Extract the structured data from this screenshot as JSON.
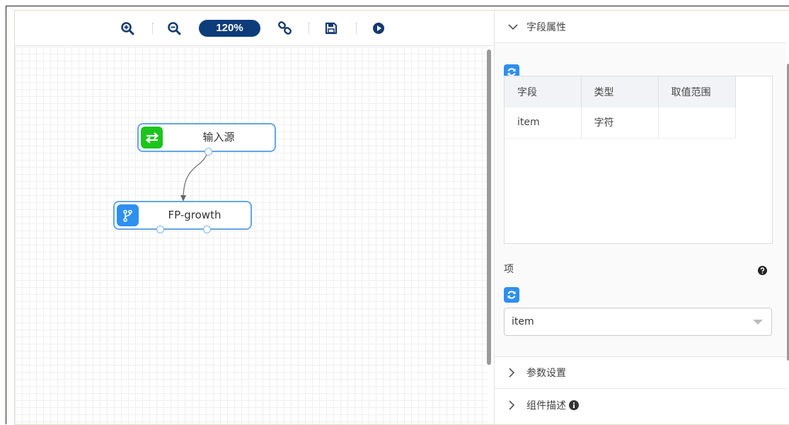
{
  "toolbar": {
    "zoom_level": "120%",
    "buttons": [
      "zoom-in-icon",
      "zoom-out-icon",
      "link-icon",
      "save-icon",
      "play-icon"
    ]
  },
  "canvas": {
    "nodes": [
      {
        "label": "输入源",
        "icon": "transfer-icon",
        "icon_color": "#1cc51c"
      },
      {
        "label": "FP-growth",
        "icon": "branch-icon",
        "icon_color": "#2d8ff0"
      }
    ]
  },
  "panel": {
    "field_section_title": "字段属性",
    "table": {
      "headers": [
        "字段",
        "类型",
        "取值范围"
      ],
      "rows": [
        [
          "item",
          "字符",
          ""
        ]
      ]
    },
    "item_label": "项",
    "item_selected": "item",
    "param_section_title": "参数设置",
    "desc_section_title": "组件描述"
  },
  "colors": {
    "accent": "#0d3c7a",
    "refresh_blue": "#2d8ff0",
    "node_border": "#63a6e6"
  }
}
